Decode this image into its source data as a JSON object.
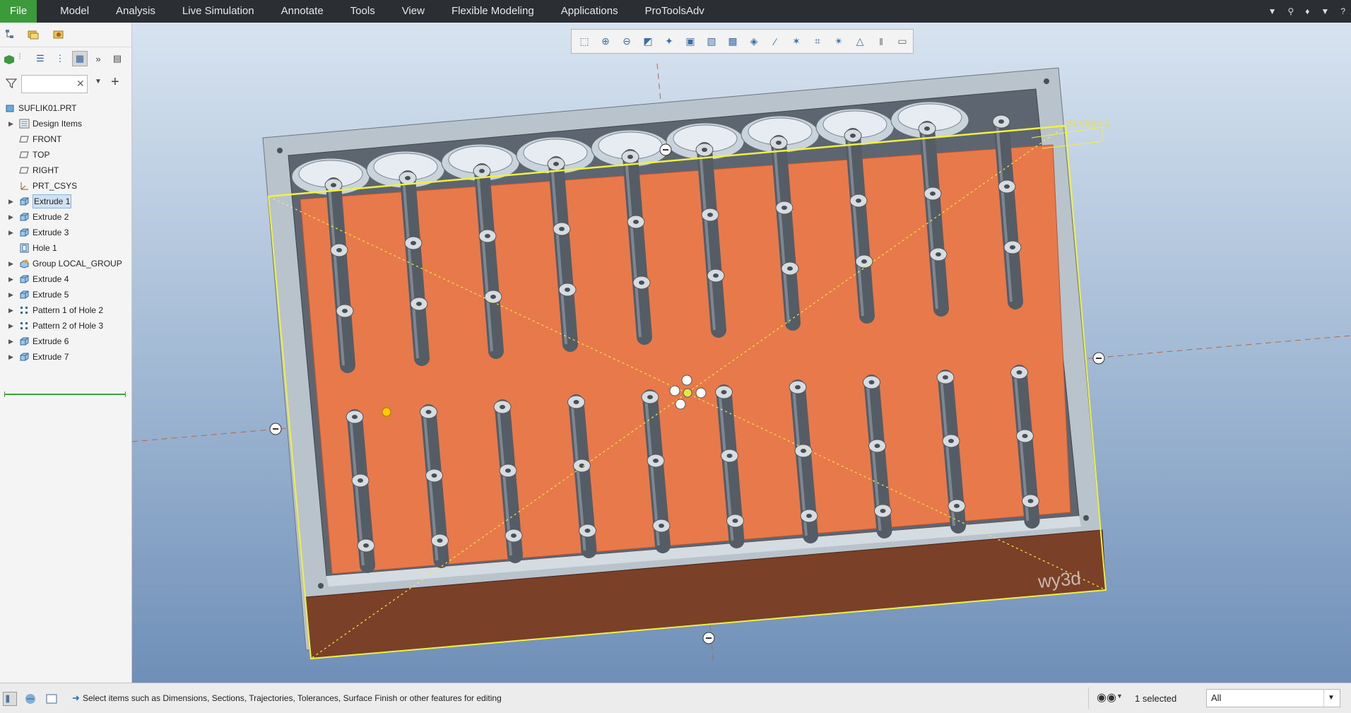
{
  "menu": {
    "items": [
      "File",
      "Model",
      "Analysis",
      "Live Simulation",
      "Annotate",
      "Tools",
      "View",
      "Flexible Modeling",
      "Applications",
      "ProToolsAdv"
    ],
    "right_icons": [
      "chevron-down-icon",
      "search-icon",
      "graduation-cap-icon",
      "chevron-down-icon",
      "help-icon"
    ]
  },
  "model_tree": {
    "search": {
      "value": "",
      "placeholder": ""
    },
    "root": "SUFLIK01.PRT",
    "items": [
      {
        "label": "Design Items",
        "icon": "layers-icon",
        "expandable": true
      },
      {
        "label": "FRONT",
        "icon": "datum-plane-icon",
        "expandable": false
      },
      {
        "label": "TOP",
        "icon": "datum-plane-icon",
        "expandable": false
      },
      {
        "label": "RIGHT",
        "icon": "datum-plane-icon",
        "expandable": false
      },
      {
        "label": "PRT_CSYS",
        "icon": "csys-icon",
        "expandable": false
      },
      {
        "label": "Extrude 1",
        "icon": "extrude-icon",
        "expandable": true,
        "selected": true
      },
      {
        "label": "Extrude 2",
        "icon": "extrude-icon",
        "expandable": true
      },
      {
        "label": "Extrude 3",
        "icon": "extrude-icon",
        "expandable": true
      },
      {
        "label": "Hole 1",
        "icon": "hole-icon",
        "expandable": false
      },
      {
        "label": "Group LOCAL_GROUP",
        "icon": "group-icon",
        "expandable": true
      },
      {
        "label": "Extrude 4",
        "icon": "extrude-icon",
        "expandable": true
      },
      {
        "label": "Extrude 5",
        "icon": "extrude-icon",
        "expandable": true
      },
      {
        "label": "Pattern 1 of Hole 2",
        "icon": "pattern-icon",
        "expandable": true
      },
      {
        "label": "Pattern 2 of Hole 3",
        "icon": "pattern-icon",
        "expandable": true
      },
      {
        "label": "Extrude 6",
        "icon": "extrude-icon",
        "expandable": true
      },
      {
        "label": "Extrude 7",
        "icon": "extrude-icon",
        "expandable": true
      }
    ]
  },
  "viewport": {
    "section_label": "Section 1",
    "watermark": "wy3d",
    "toolbar_icons": [
      "refit-icon",
      "zoom-in-icon",
      "zoom-out-icon",
      "repaint-icon",
      "view-manager-icon",
      "saved-orientations-icon",
      "display-style-icon",
      "section-icon",
      "datum-display-icon",
      "annotation-display-icon",
      "csys-display-icon",
      "spin-center-icon",
      "trajectory-icon",
      "measure-icon",
      "pause-icon",
      "disabled-icon"
    ]
  },
  "status": {
    "message": "Select items such as Dimensions, Sections, Trajectories, Tolerances, Surface Finish or other features for editing",
    "selected": "1 selected",
    "filter": "All"
  },
  "colors": {
    "menubar": "#2b2f33",
    "file_tab": "#3b9b3b",
    "model_face": "#e8794a",
    "frame": "#b9c3cc",
    "highlight": "#f0f040",
    "side_face": "#7a4028"
  }
}
